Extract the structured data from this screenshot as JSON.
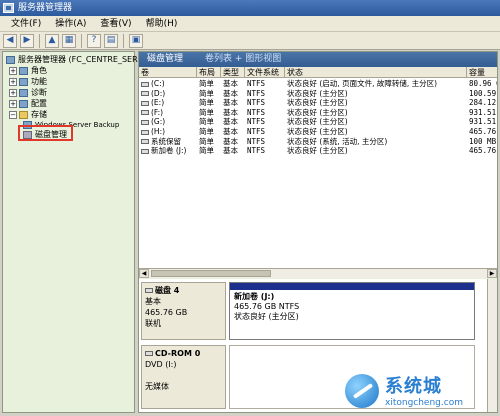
{
  "window": {
    "title": "服务器管理器"
  },
  "menu": [
    "文件(F)",
    "操作(A)",
    "查看(V)",
    "帮助(H)"
  ],
  "tree": {
    "root": "服务器管理器 (FC_CENTRE_SER3",
    "items": [
      "角色",
      "功能",
      "诊断",
      "配置",
      "存储"
    ],
    "storage_children": [
      "Windows Server Backup",
      "磁盘管理"
    ]
  },
  "panel": {
    "title": "磁盘管理",
    "view_label": "卷列表 + 图形视图"
  },
  "columns": [
    "卷",
    "布局",
    "类型",
    "文件系统",
    "状态",
    "容量"
  ],
  "volumes": [
    {
      "name": "(C:)",
      "layout": "简单",
      "type": "基本",
      "fs": "NTFS",
      "status": "状态良好 (启动, 页面文件, 故障转储, 主分区)",
      "capacity": "80.96 GB"
    },
    {
      "name": "(D:)",
      "layout": "简单",
      "type": "基本",
      "fs": "NTFS",
      "status": "状态良好 (主分区)",
      "capacity": "100.59"
    },
    {
      "name": "(E:)",
      "layout": "简单",
      "type": "基本",
      "fs": "NTFS",
      "status": "状态良好 (主分区)",
      "capacity": "284.12"
    },
    {
      "name": "(F:)",
      "layout": "简单",
      "type": "基本",
      "fs": "NTFS",
      "status": "状态良好 (主分区)",
      "capacity": "931.51"
    },
    {
      "name": "(G:)",
      "layout": "简单",
      "type": "基本",
      "fs": "NTFS",
      "status": "状态良好 (主分区)",
      "capacity": "931.51"
    },
    {
      "name": "(H:)",
      "layout": "简单",
      "type": "基本",
      "fs": "NTFS",
      "status": "状态良好 (主分区)",
      "capacity": "465.76"
    },
    {
      "name": "系统保留",
      "layout": "简单",
      "type": "基本",
      "fs": "NTFS",
      "status": "状态良好 (系统, 活动, 主分区)",
      "capacity": "100 MB"
    },
    {
      "name": "新加卷 (J:)",
      "layout": "简单",
      "type": "基本",
      "fs": "NTFS",
      "status": "状态良好 (主分区)",
      "capacity": "465.76"
    }
  ],
  "disk4": {
    "name": "磁盘 4",
    "kind": "基本",
    "size": "465.76 GB",
    "state": "联机",
    "partition": {
      "name": "新加卷 (J:)",
      "size_fs": "465.76 GB NTFS",
      "status": "状态良好 (主分区)"
    }
  },
  "cdrom": {
    "name": "CD-ROM 0",
    "kind": "DVD (I:)",
    "state": "无媒体"
  },
  "watermark": {
    "brand": "系统城",
    "url": "xitongcheng.com"
  }
}
